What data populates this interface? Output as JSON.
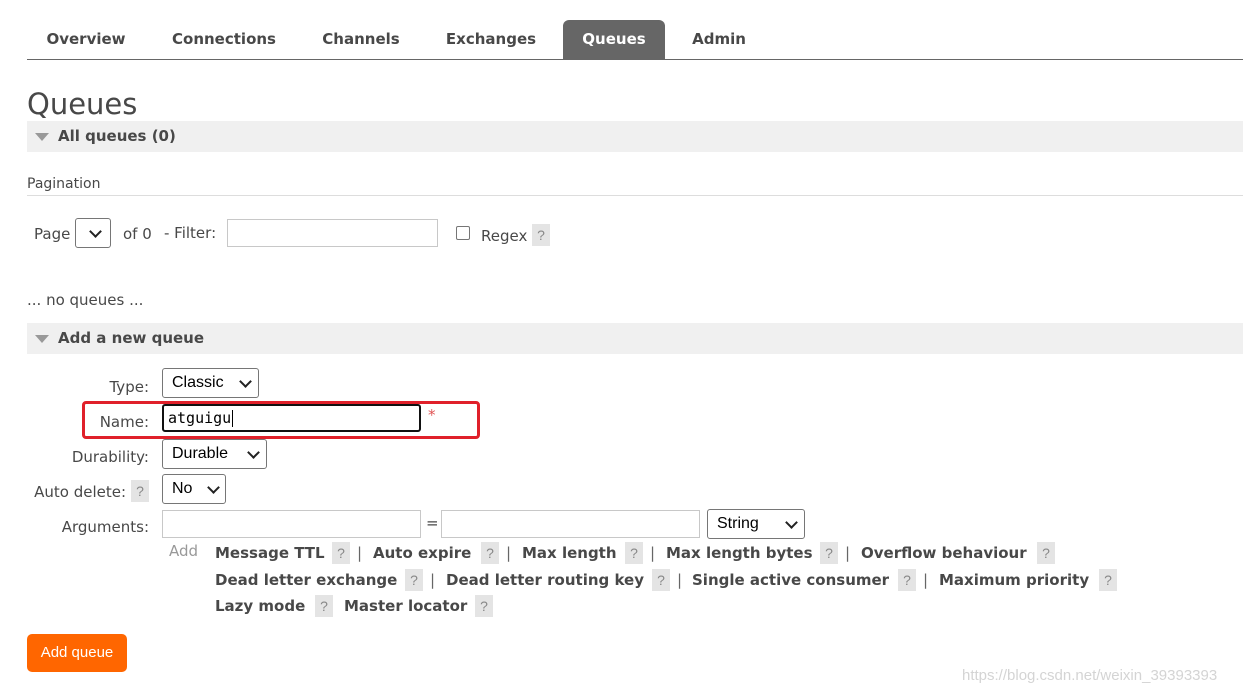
{
  "nav": {
    "tabs": [
      {
        "label": "Overview",
        "active": false
      },
      {
        "label": "Connections",
        "active": false
      },
      {
        "label": "Channels",
        "active": false
      },
      {
        "label": "Exchanges",
        "active": false
      },
      {
        "label": "Queues",
        "active": true
      },
      {
        "label": "Admin",
        "active": false
      }
    ]
  },
  "page": {
    "title": "Queues"
  },
  "all_queues": {
    "heading": "All queues (0)",
    "pagination_label": "Pagination",
    "page_label": "Page",
    "page_value": "",
    "of_label": "of 0",
    "filter_label": "- Filter:",
    "filter_value": "",
    "regex_label": "Regex",
    "regex_checked": false,
    "help_label": "?",
    "empty_text": "... no queues ..."
  },
  "add_queue": {
    "heading": "Add a new queue",
    "type_label": "Type:",
    "type_value": "Classic",
    "name_label": "Name:",
    "name_value": "atguigu",
    "required_marker": "*",
    "durability_label": "Durability:",
    "durability_value": "Durable",
    "auto_delete_label": "Auto delete:",
    "auto_delete_value": "No",
    "arguments_label": "Arguments:",
    "argument_key": "",
    "argument_equals": "=",
    "argument_value": "",
    "argument_type": "String",
    "add_label": "Add",
    "separator": "|",
    "argument_shortcuts": [
      "Message TTL",
      "Auto expire",
      "Max length",
      "Max length bytes",
      "Overflow behaviour",
      "Dead letter exchange",
      "Dead letter routing key",
      "Single active consumer",
      "Maximum priority",
      "Lazy mode",
      "Master locator"
    ],
    "submit_label": "Add queue"
  },
  "watermark": "https://blog.csdn.net/weixin_39393393",
  "colors": {
    "accent": "#ff6600",
    "highlight": "#e0202a",
    "tab_active": "#666666"
  }
}
